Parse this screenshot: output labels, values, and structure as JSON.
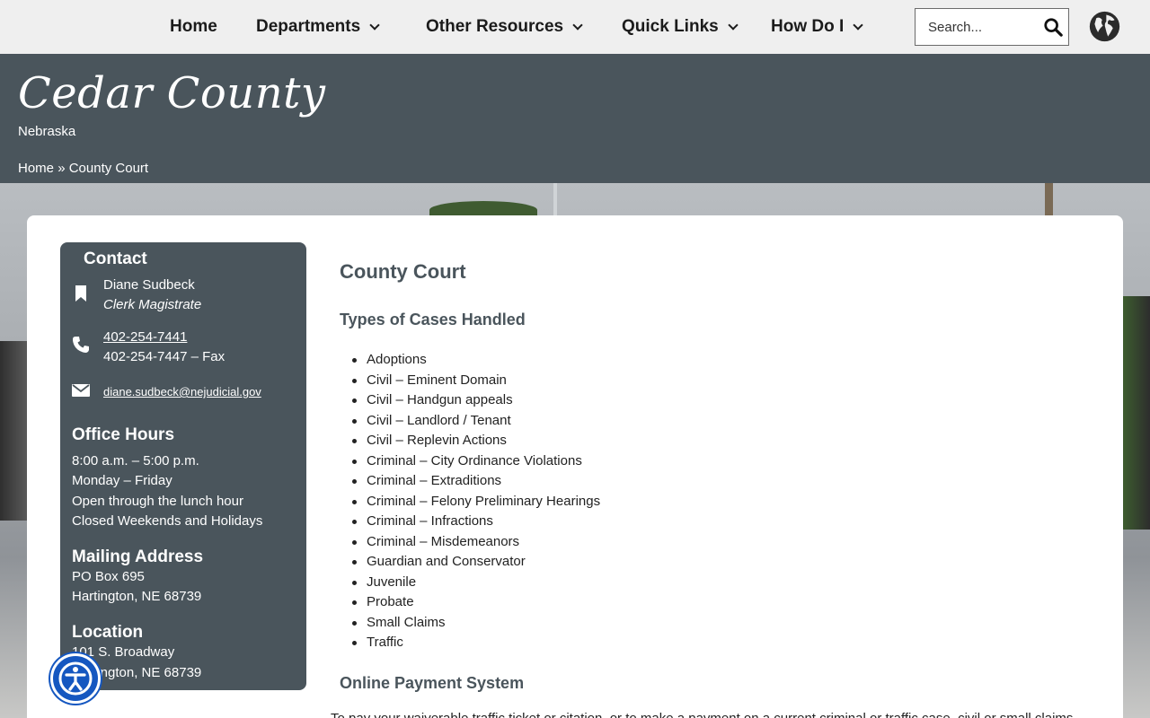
{
  "nav": {
    "items": [
      {
        "label": "Home",
        "dropdown": false
      },
      {
        "label": "Departments",
        "dropdown": true
      },
      {
        "label": "Other Resources",
        "dropdown": true
      },
      {
        "label": "Quick Links",
        "dropdown": true
      },
      {
        "label": "How Do I",
        "dropdown": true
      }
    ],
    "search_placeholder": "Search...",
    "icons": {
      "search": "search-icon",
      "language": "globe-icon"
    }
  },
  "header": {
    "site_title": "Cedar County",
    "site_subtitle": "Nebraska",
    "breadcrumb": {
      "home": "Home",
      "separator": "»",
      "current": "County Court"
    }
  },
  "sidebar": {
    "contact_heading": "Contact",
    "contact_name": "Diane Sudbeck",
    "contact_role": "Clerk Magistrate",
    "phone": "402-254-7441",
    "fax": "402-254-7447 – Fax",
    "email": "diane.sudbeck@nejudicial.gov",
    "hours_heading": "Office Hours",
    "hours": [
      "8:00 a.m. – 5:00 p.m.",
      "Monday – Friday",
      "Open through the lunch hour",
      "Closed Weekends and Holidays"
    ],
    "mailing_heading": "Mailing Address",
    "mailing": [
      "PO Box 695",
      "Hartington, NE 68739"
    ],
    "location_heading": "Location",
    "location": [
      "101 S. Broadway",
      "Hartington, NE 68739"
    ]
  },
  "main": {
    "title": "County Court",
    "cases_heading": "Types of Cases Handled",
    "cases": [
      "Adoptions",
      "Civil – Eminent Domain",
      "Civil – Handgun appeals",
      "Civil – Landlord / Tenant",
      "Civil – Replevin Actions",
      "Criminal – City Ordinance Violations",
      "Criminal – Extraditions",
      "Criminal – Felony Preliminary Hearings",
      "Criminal – Infractions",
      "Criminal – Misdemeanors",
      "Guardian and Conservator",
      "Juvenile",
      "Probate",
      "Small Claims",
      "Traffic"
    ],
    "payment_heading": "Online Payment System",
    "payment_text": "To pay your waiverable traffic ticket or citation, or to make a payment on a current criminal or traffic case, civil or small claims"
  },
  "colors": {
    "header_bg": "#4a555c",
    "nav_bg": "#efefef",
    "accent_a11y": "#1557c0"
  }
}
